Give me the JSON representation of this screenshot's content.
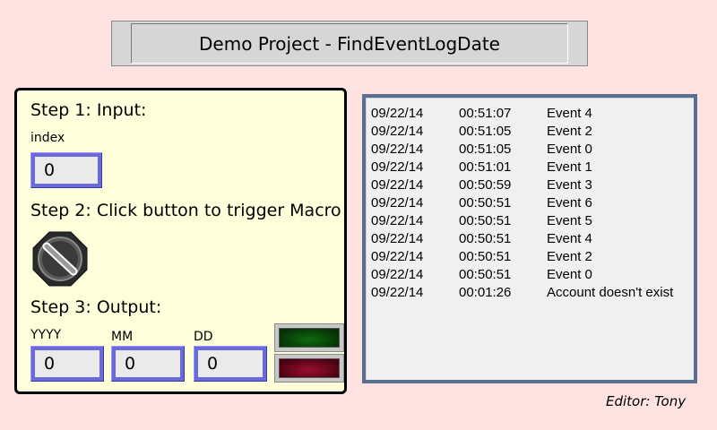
{
  "title": "Demo Project - FindEventLogDate",
  "step1": {
    "label": "Step 1: Input:",
    "field_label": "index",
    "value": "0"
  },
  "step2": {
    "label": "Step 2: Click button to trigger Macro"
  },
  "step3": {
    "label": "Step 3: Output:",
    "yyyy_label": "YYYY",
    "yyyy_value": "0",
    "mm_label": "MM",
    "mm_value": "0",
    "dd_label": "DD",
    "dd_value": "0"
  },
  "lamps": {
    "green": "#0f6a0f",
    "red": "#9a1030"
  },
  "event_log": [
    {
      "date": "09/22/14",
      "time": "00:51:07",
      "event": "Event 4"
    },
    {
      "date": "09/22/14",
      "time": "00:51:05",
      "event": "Event 2"
    },
    {
      "date": "09/22/14",
      "time": "00:51:05",
      "event": "Event 0"
    },
    {
      "date": "09/22/14",
      "time": "00:51:01",
      "event": "Event 1"
    },
    {
      "date": "09/22/14",
      "time": "00:50:59",
      "event": "Event 3"
    },
    {
      "date": "09/22/14",
      "time": "00:50:51",
      "event": "Event 6"
    },
    {
      "date": "09/22/14",
      "time": "00:50:51",
      "event": "Event 5"
    },
    {
      "date": "09/22/14",
      "time": "00:50:51",
      "event": "Event 4"
    },
    {
      "date": "09/22/14",
      "time": "00:50:51",
      "event": "Event 2"
    },
    {
      "date": "09/22/14",
      "time": "00:50:51",
      "event": "Event 0"
    },
    {
      "date": "09/22/14",
      "time": "00:01:26",
      "event": "Account doesn't exist"
    }
  ],
  "editor": "Editor: Tony"
}
